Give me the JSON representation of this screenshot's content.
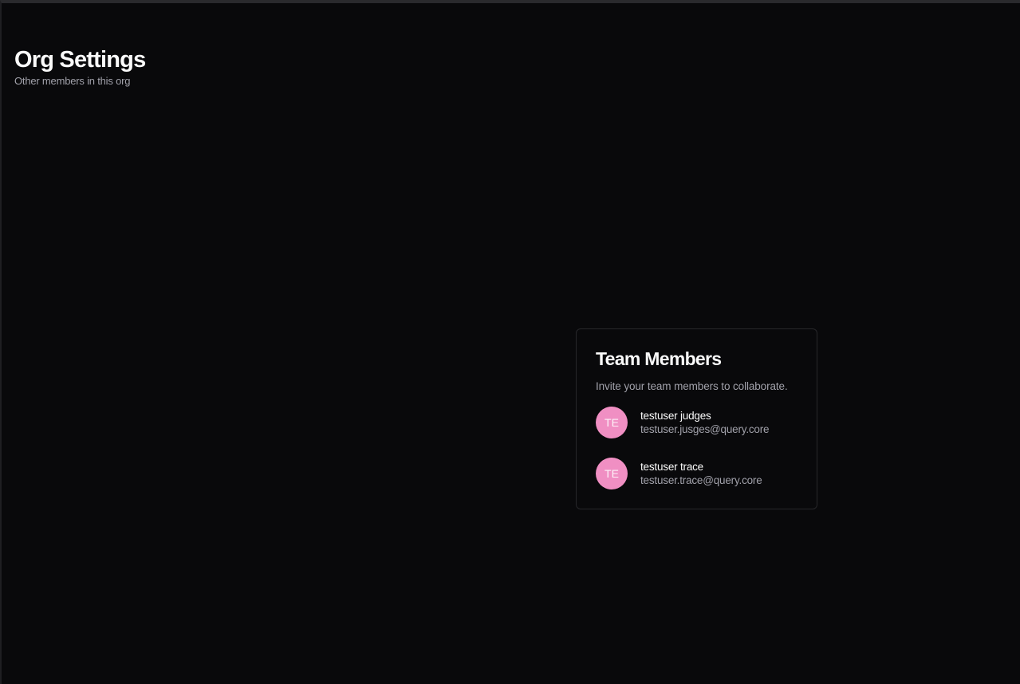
{
  "header": {
    "title": "Org Settings",
    "subtitle": "Other members in this org"
  },
  "team_card": {
    "title": "Team Members",
    "description": "Invite your team members to collaborate.",
    "members": [
      {
        "initials": "TE",
        "name": "testuser judges",
        "email": "testuser.jusges@query.core",
        "avatar_color": "#f08fc3"
      },
      {
        "initials": "TE",
        "name": "testuser trace",
        "email": "testuser.trace@query.core",
        "avatar_color": "#f08fc3"
      }
    ]
  },
  "theme": {
    "background": "#09090b",
    "text_primary": "#fafafa",
    "text_muted": "#a1a1aa",
    "border": "#27272a"
  }
}
